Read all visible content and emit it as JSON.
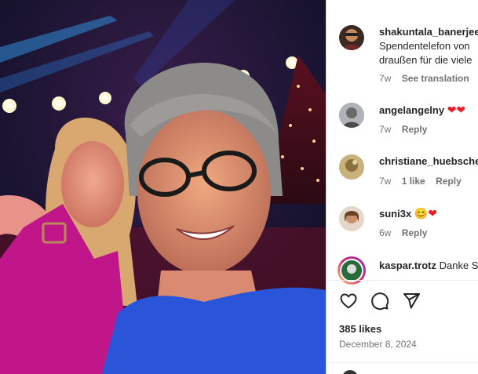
{
  "post": {
    "likes_text": "385 likes",
    "date_text": "December 8, 2024"
  },
  "comments": [
    {
      "username": "shakuntala_banerjee",
      "lines": [
        "Spendentelefon von",
        "draußen für die viele"
      ],
      "time": "7w",
      "action": "See translation"
    },
    {
      "username": "angelangelny",
      "text": "❤❤",
      "time": "7w",
      "action": "Reply"
    },
    {
      "username": "christiane_huebscher",
      "text": "",
      "time": "7w",
      "likes": "1 like",
      "action": "Reply"
    },
    {
      "username": "suni3x",
      "text": "😊❤",
      "time": "6w",
      "action": "Reply"
    },
    {
      "username": "kaspar.trotz",
      "text": "Danke S"
    }
  ],
  "icons": {
    "like": "heart-outline-icon",
    "comment": "speech-bubble-icon",
    "share": "paper-plane-icon"
  },
  "colors": {
    "heart_red": "#ed1c24",
    "muted": "#737373",
    "accent_purple": "#c0168a"
  }
}
